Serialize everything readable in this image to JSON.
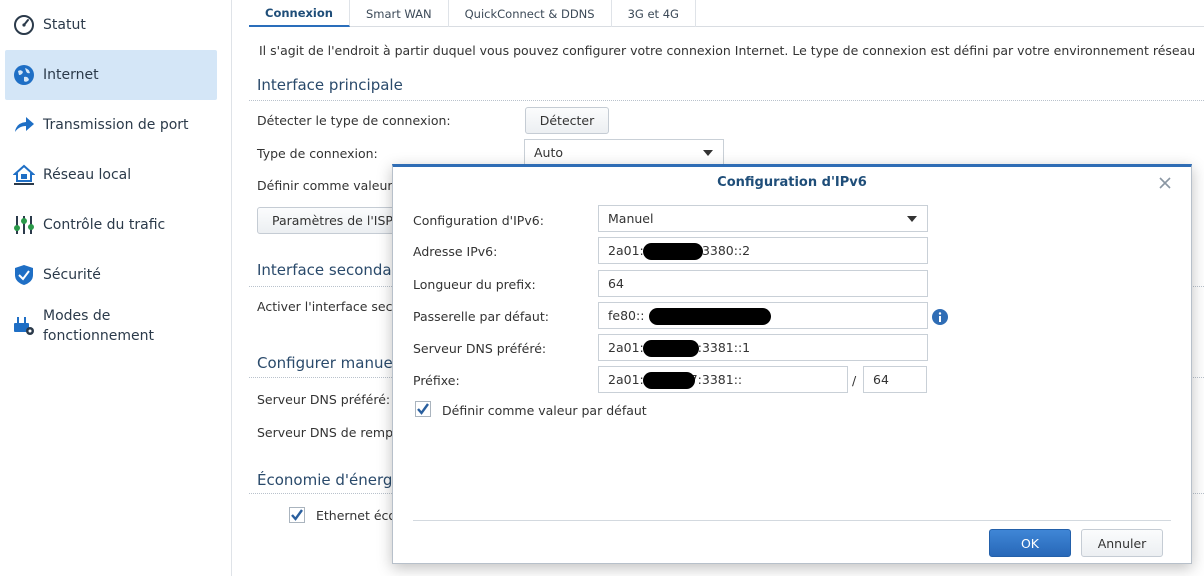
{
  "sidebar": {
    "items": [
      {
        "label": "Statut",
        "icon": "gauge-icon"
      },
      {
        "label": "Internet",
        "icon": "globe-icon",
        "active": true
      },
      {
        "label": "Transmission de port",
        "icon": "arrow-forward-icon"
      },
      {
        "label": "Réseau local",
        "icon": "home-network-icon"
      },
      {
        "label": "Contrôle du trafic",
        "icon": "sliders-icon"
      },
      {
        "label": "Sécurité",
        "icon": "shield-icon"
      },
      {
        "label_line1": "Modes de",
        "label_line2": "fonctionnement",
        "icon": "router-gear-icon"
      }
    ]
  },
  "tabs": [
    {
      "label": "Connexion",
      "active": true
    },
    {
      "label": "Smart WAN"
    },
    {
      "label": "QuickConnect & DDNS"
    },
    {
      "label": "3G et 4G"
    }
  ],
  "main": {
    "intro": "Il s'agit de l'endroit à partir duquel vous pouvez configurer votre connexion Internet. Le type de connexion est défini par votre environnement réseau",
    "sec_primary": "Interface principale",
    "detect_label": "Détecter le type de connexion:",
    "detect_button": "Détecter",
    "conn_type_label": "Type de connexion:",
    "conn_type_value": "Auto",
    "default_label": "Définir comme valeur",
    "isp_button": "Paramètres de l'ISP",
    "sec_secondary": "Interface secondai",
    "enable_secondary": "Activer l'interface seco",
    "sec_manual": "Configurer manuel",
    "dns_pref": "Serveur DNS préféré:",
    "dns_alt": "Serveur DNS de remp",
    "sec_energy": "Économie d'énergie",
    "ethernet_label": "Ethernet éco"
  },
  "modal": {
    "title": "Configuration d'IPv6",
    "fields": {
      "config_label": "Configuration d'IPv6:",
      "config_value": "Manuel",
      "addr_label": "Adresse IPv6:",
      "addr_prefix": "2a01:",
      "addr_suffix": ":3380::2",
      "prefix_len_label": "Longueur du prefix:",
      "prefix_len_value": "64",
      "gateway_label": "Passerelle par défaut:",
      "gateway_prefix": "fe80::",
      "dns_label": "Serveur DNS préféré:",
      "dns_prefix": "2a01:",
      "dns_suffix": ":3381::1",
      "prefixe_label": "Préfixe:",
      "prefixe_prefix": "2a01:",
      "prefixe_suffix": "7:3381::",
      "slash": "/",
      "prefixe_len": "64",
      "default_checkbox": "Définir comme valeur par défaut"
    },
    "ok_button": "OK",
    "cancel_button": "Annuler"
  },
  "colors": {
    "accent": "#2f6db5",
    "active_bg": "#d4e6f7",
    "icon_blue": "#1f6fc5"
  }
}
